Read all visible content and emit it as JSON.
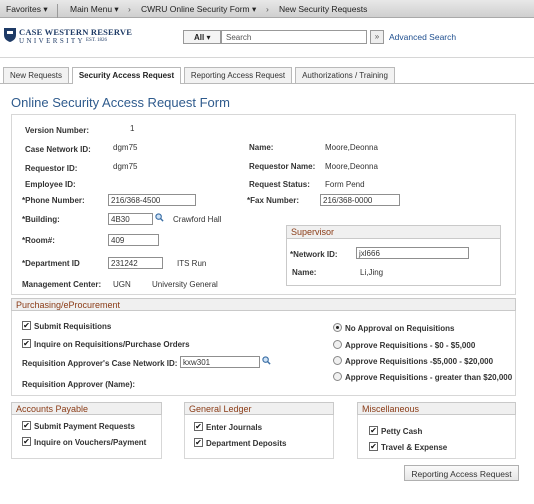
{
  "topnav": {
    "favorites": "Favorites",
    "main_menu": "Main Menu",
    "crumb1": "CWRU Online Security Form",
    "crumb2": "New Security Requests"
  },
  "logo": {
    "line1": "CASE WESTERN RESERVE",
    "line2": "UNIVERSITY",
    "est": "EST. 1826"
  },
  "search": {
    "scope": "All",
    "placeholder": "Search",
    "advanced": "Advanced Search"
  },
  "tabs": [
    "New Requests",
    "Security Access Request",
    "Reporting Access Request",
    "Authorizations / Training"
  ],
  "page_title": "Online Security Access Request Form",
  "form": {
    "version_label": "Version Number:",
    "version": "1",
    "network_id_label": "Case Network ID:",
    "network_id": "dgm75",
    "requestor_id_label": "Requestor ID:",
    "requestor_id": "dgm75",
    "employee_id_label": "Employee ID:",
    "name_label": "Name:",
    "name": "Moore,Deonna",
    "requestor_name_label": "Requestor Name:",
    "requestor_name": "Moore,Deonna",
    "request_status_label": "Request Status:",
    "request_status": "Form Pend",
    "phone_label": "*Phone Number:",
    "phone": "216/368-4500",
    "fax_label": "*Fax Number:",
    "fax": "216/368-0000",
    "building_label": "*Building:",
    "building": "4B30",
    "building_name": "Crawford Hall",
    "room_label": "*Room#:",
    "room": "409",
    "dept_label": "*Department ID",
    "dept": "231242",
    "dept_name": "ITS Run",
    "mgmt_label": "Management Center:",
    "mgmt_code": "UGN",
    "mgmt_name": "University General"
  },
  "supervisor": {
    "title": "Supervisor",
    "net_label": "*Network ID:",
    "net": "jxl666",
    "name_label": "Name:",
    "name": "Li,Jing"
  },
  "purchasing": {
    "title": "Purchasing/eProcurement",
    "submit": "Submit Requisitions",
    "inquire": "Inquire on Requisitions/Purchase Orders",
    "approver_label": "Requisition Approver's Case Network ID:",
    "approver": "kxw301",
    "approver_name_label": "Requisition Approver (Name):",
    "radios": [
      "No Approval on Requisitions",
      "Approve Requisitions - $0 - $5,000",
      "Approve Requisitions -$5,000 - $20,000",
      "Approve Requisitions - greater than $20,000"
    ]
  },
  "ap": {
    "title": "Accounts Payable",
    "item1": "Submit Payment Requests",
    "item2": "Inquire on Vouchers/Payment"
  },
  "gl": {
    "title": "General Ledger",
    "item1": "Enter Journals",
    "item2": "Department Deposits"
  },
  "misc": {
    "title": "Miscellaneous",
    "item1": "Petty Cash",
    "item2": "Travel & Expense"
  },
  "footer_button": "Reporting Access Request",
  "colors": {
    "title": "#2f5b8d",
    "section": "#8a3b16",
    "link": "#1f4f8f"
  }
}
